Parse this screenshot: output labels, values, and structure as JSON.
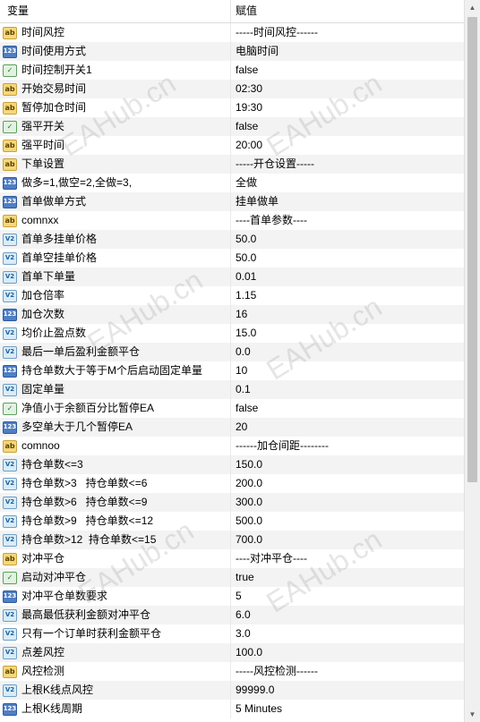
{
  "header": {
    "col_name": "变量",
    "col_value": "赋值"
  },
  "rows": [
    {
      "icon": "ab",
      "name": "时间风控",
      "value": "-----时间风控------"
    },
    {
      "icon": "123",
      "name": "时间使用方式",
      "value": "电脑时间"
    },
    {
      "icon": "bool",
      "name": "时间控制开关1",
      "value": "false"
    },
    {
      "icon": "ab",
      "name": "开始交易时间",
      "value": "02:30"
    },
    {
      "icon": "ab",
      "name": "暂停加仓时间",
      "value": "19:30"
    },
    {
      "icon": "bool",
      "name": "强平开关",
      "value": "false"
    },
    {
      "icon": "ab",
      "name": "强平时间",
      "value": "20:00"
    },
    {
      "icon": "ab",
      "name": "下单设置",
      "value": "-----开仓设置-----"
    },
    {
      "icon": "123",
      "name": "做多=1,做空=2,全做=3,",
      "value": "全做"
    },
    {
      "icon": "123",
      "name": "首单做单方式",
      "value": "挂单做单"
    },
    {
      "icon": "ab",
      "name": "comnxx",
      "value": "----首单参数----"
    },
    {
      "icon": "v2",
      "name": "首单多挂单价格",
      "value": "50.0"
    },
    {
      "icon": "v2",
      "name": "首单空挂单价格",
      "value": "50.0"
    },
    {
      "icon": "v2",
      "name": "首单下单量",
      "value": "0.01"
    },
    {
      "icon": "v2",
      "name": "加仓倍率",
      "value": "1.15"
    },
    {
      "icon": "123",
      "name": "加仓次数",
      "value": "16"
    },
    {
      "icon": "v2",
      "name": "均价止盈点数",
      "value": "15.0"
    },
    {
      "icon": "v2",
      "name": "最后一单后盈利金额平仓",
      "value": "0.0"
    },
    {
      "icon": "123",
      "name": "持仓单数大于等于M个后启动固定单量",
      "value": "10"
    },
    {
      "icon": "v2",
      "name": "固定单量",
      "value": "0.1"
    },
    {
      "icon": "bool",
      "name": "净值小于余额百分比暂停EA",
      "value": "false"
    },
    {
      "icon": "123",
      "name": "多空单大于几个暂停EA",
      "value": "20"
    },
    {
      "icon": "ab",
      "name": "comnoo",
      "value": "------加仓间距--------"
    },
    {
      "icon": "v2",
      "name": "持仓单数<=3",
      "value": "150.0"
    },
    {
      "icon": "v2",
      "name": "持仓单数>3   持仓单数<=6",
      "value": "200.0"
    },
    {
      "icon": "v2",
      "name": "持仓单数>6   持仓单数<=9",
      "value": "300.0"
    },
    {
      "icon": "v2",
      "name": "持仓单数>9   持仓单数<=12",
      "value": "500.0"
    },
    {
      "icon": "v2",
      "name": "持仓单数>12  持仓单数<=15",
      "value": "700.0"
    },
    {
      "icon": "ab",
      "name": "对冲平仓",
      "value": "----对冲平仓----"
    },
    {
      "icon": "bool",
      "name": "启动对冲平仓",
      "value": "true"
    },
    {
      "icon": "123",
      "name": "对冲平仓单数要求",
      "value": "5"
    },
    {
      "icon": "v2",
      "name": "最高最低获利金额对冲平仓",
      "value": "6.0"
    },
    {
      "icon": "v2",
      "name": "只有一个订单时获利金额平仓",
      "value": "3.0"
    },
    {
      "icon": "v2",
      "name": "点差风控",
      "value": "100.0"
    },
    {
      "icon": "ab",
      "name": "风控检测",
      "value": "-----风控检测------"
    },
    {
      "icon": "v2",
      "name": "上根K线点风控",
      "value": "99999.0"
    },
    {
      "icon": "123",
      "name": "上根K线周期",
      "value": "5 Minutes"
    }
  ],
  "watermark": "EAHub.cn",
  "icon_labels": {
    "ab": "ab",
    "123": "123",
    "v2": "V2",
    "bool": "✓"
  }
}
